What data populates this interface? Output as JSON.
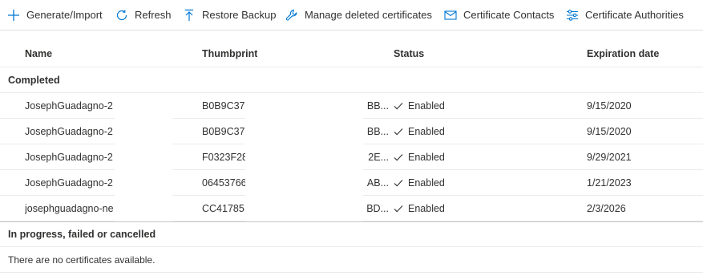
{
  "toolbar": {
    "items": [
      {
        "label": "Generate/Import",
        "icon": "plus-icon"
      },
      {
        "label": "Refresh",
        "icon": "refresh-icon"
      },
      {
        "label": "Restore Backup",
        "icon": "upload-icon"
      },
      {
        "label": "Manage deleted certificates",
        "icon": "wrench-icon"
      },
      {
        "label": "Certificate Contacts",
        "icon": "mail-icon"
      },
      {
        "label": "Certificate Authorities",
        "icon": "settings-sliders-icon"
      }
    ],
    "accent": "#0078d4"
  },
  "table": {
    "columns": [
      "Name",
      "Thumbprint",
      "Status",
      "Expiration date"
    ],
    "groups": [
      {
        "label": "Completed",
        "rows": [
          {
            "name": "JosephGuadagno-2",
            "thumbprint": "B0B9C37",
            "thumb_tail": "BB...",
            "status": "Enabled",
            "expiration": "9/15/2020"
          },
          {
            "name": "JosephGuadagno-2",
            "thumbprint": "B0B9C37",
            "thumb_tail": "BB...",
            "status": "Enabled",
            "expiration": "9/15/2020"
          },
          {
            "name": "JosephGuadagno-2",
            "thumbprint": "F0323F28",
            "thumb_tail": "2E...",
            "status": "Enabled",
            "expiration": "9/29/2021"
          },
          {
            "name": "JosephGuadagno-2",
            "thumbprint": "06453766",
            "thumb_tail": "AB...",
            "status": "Enabled",
            "expiration": "1/21/2023"
          },
          {
            "name": "josephguadagno-ne",
            "thumbprint": "CC41785",
            "thumb_tail": "BD...",
            "status": "Enabled",
            "expiration": "2/3/2026"
          }
        ]
      },
      {
        "label": "In progress, failed or cancelled",
        "empty_message": "There are no certificates available."
      }
    ]
  }
}
